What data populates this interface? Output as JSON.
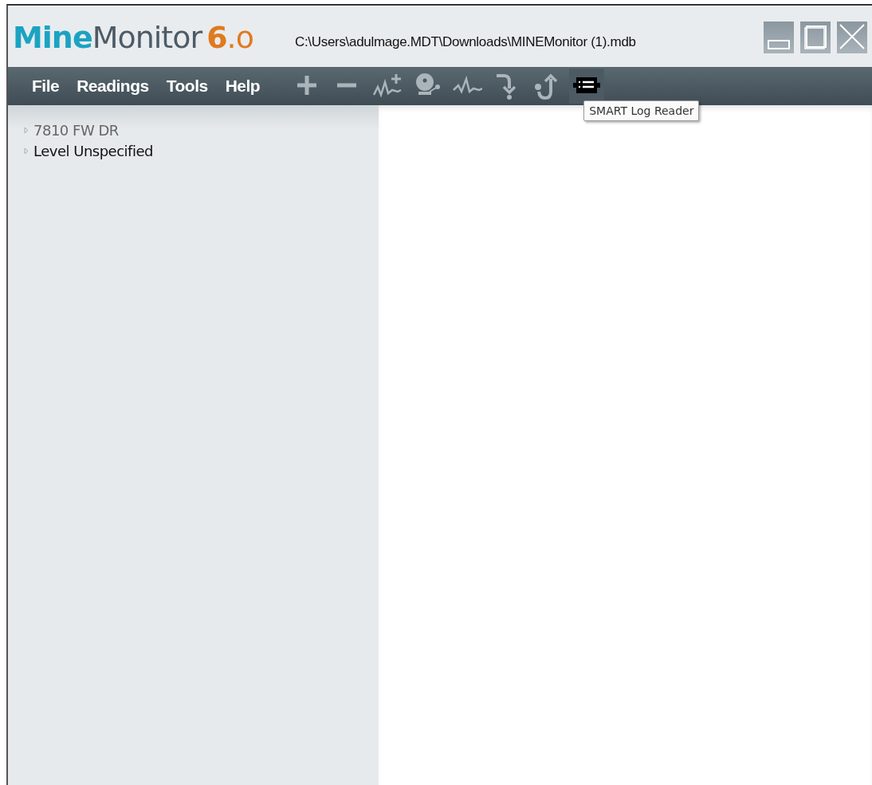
{
  "logo": [
    {
      "text": "Mine",
      "kind": "brand"
    },
    {
      "text": "Monitor",
      "kind": "name"
    },
    {
      "text": "6",
      "kind": "major"
    },
    {
      "text": ".o",
      "kind": "minor"
    }
  ],
  "window": {
    "title": "C:\\Users\\adulmage.MDT\\Downloads\\MINEMonitor (1).mdb",
    "controls": [
      {
        "kind": "minimize"
      },
      {
        "kind": "maximize"
      },
      {
        "kind": "close"
      }
    ]
  },
  "menu": [
    "File",
    "Readings",
    "Tools",
    "Help"
  ],
  "toolbar": [
    {
      "kind": "add",
      "selected": false
    },
    {
      "kind": "remove",
      "selected": false
    },
    {
      "kind": "add-reading",
      "selected": false
    },
    {
      "kind": "alarm",
      "selected": false
    },
    {
      "kind": "reading",
      "selected": false
    },
    {
      "kind": "down",
      "selected": false
    },
    {
      "kind": "up",
      "selected": false
    },
    {
      "kind": "logger",
      "selected": true
    }
  ],
  "tooltip": "SMART Log Reader",
  "tree": [
    {
      "label": "7810 FW DR",
      "selected": false,
      "expanded": false
    },
    {
      "label": "Level Unspecified",
      "selected": true,
      "expanded": false
    }
  ]
}
